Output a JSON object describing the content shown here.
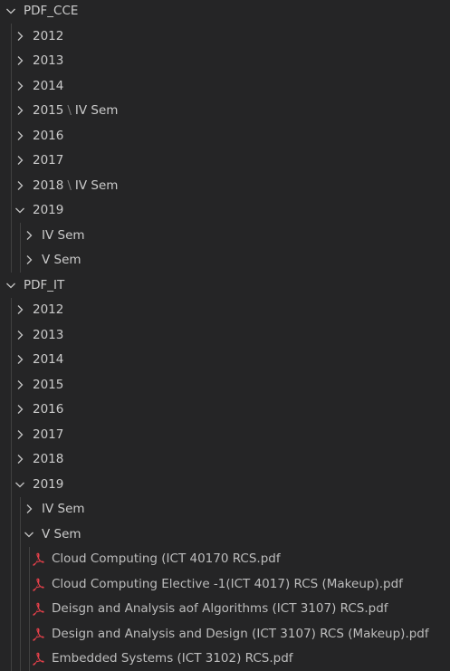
{
  "explorer": {
    "rows": [
      {
        "depth": 0,
        "type": "folder",
        "expanded": true,
        "label": "PDF_CCE",
        "name": "folder-pdf-cce"
      },
      {
        "depth": 1,
        "type": "folder",
        "expanded": false,
        "label": "2012",
        "name": "folder-cce-2012"
      },
      {
        "depth": 1,
        "type": "folder",
        "expanded": false,
        "label": "2013",
        "name": "folder-cce-2013"
      },
      {
        "depth": 1,
        "type": "folder",
        "expanded": false,
        "label": "2014",
        "name": "folder-cce-2014"
      },
      {
        "depth": 1,
        "type": "folder",
        "expanded": false,
        "label": "2015",
        "sub": "IV Sem",
        "name": "folder-cce-2015"
      },
      {
        "depth": 1,
        "type": "folder",
        "expanded": false,
        "label": "2016",
        "name": "folder-cce-2016"
      },
      {
        "depth": 1,
        "type": "folder",
        "expanded": false,
        "label": "2017",
        "name": "folder-cce-2017"
      },
      {
        "depth": 1,
        "type": "folder",
        "expanded": false,
        "label": "2018",
        "sub": "IV Sem",
        "name": "folder-cce-2018"
      },
      {
        "depth": 1,
        "type": "folder",
        "expanded": true,
        "label": "2019",
        "name": "folder-cce-2019"
      },
      {
        "depth": 2,
        "type": "folder",
        "expanded": false,
        "label": "IV Sem",
        "name": "folder-cce-2019-iv-sem"
      },
      {
        "depth": 2,
        "type": "folder",
        "expanded": false,
        "label": "V Sem",
        "name": "folder-cce-2019-v-sem"
      },
      {
        "depth": 0,
        "type": "folder",
        "expanded": true,
        "label": "PDF_IT",
        "name": "folder-pdf-it"
      },
      {
        "depth": 1,
        "type": "folder",
        "expanded": false,
        "label": "2012",
        "name": "folder-it-2012"
      },
      {
        "depth": 1,
        "type": "folder",
        "expanded": false,
        "label": "2013",
        "name": "folder-it-2013"
      },
      {
        "depth": 1,
        "type": "folder",
        "expanded": false,
        "label": "2014",
        "name": "folder-it-2014"
      },
      {
        "depth": 1,
        "type": "folder",
        "expanded": false,
        "label": "2015",
        "name": "folder-it-2015"
      },
      {
        "depth": 1,
        "type": "folder",
        "expanded": false,
        "label": "2016",
        "name": "folder-it-2016"
      },
      {
        "depth": 1,
        "type": "folder",
        "expanded": false,
        "label": "2017",
        "name": "folder-it-2017"
      },
      {
        "depth": 1,
        "type": "folder",
        "expanded": false,
        "label": "2018",
        "name": "folder-it-2018"
      },
      {
        "depth": 1,
        "type": "folder",
        "expanded": true,
        "label": "2019",
        "name": "folder-it-2019"
      },
      {
        "depth": 2,
        "type": "folder",
        "expanded": false,
        "label": "IV Sem",
        "name": "folder-it-2019-iv-sem"
      },
      {
        "depth": 2,
        "type": "folder",
        "expanded": true,
        "label": "V Sem",
        "name": "folder-it-2019-v-sem"
      },
      {
        "depth": 3,
        "type": "file",
        "label": "Cloud Computing (ICT 40170 RCS.pdf",
        "name": "file-cloud-computing"
      },
      {
        "depth": 3,
        "type": "file",
        "label": "Cloud Computing Elective -1(ICT 4017) RCS (Makeup).pdf",
        "name": "file-cloud-computing-elective"
      },
      {
        "depth": 3,
        "type": "file",
        "label": "Deisgn and Analysis aof Algorithms (ICT 3107) RCS.pdf",
        "name": "file-design-analysis-algorithms"
      },
      {
        "depth": 3,
        "type": "file",
        "label": "Design and Analysis and Design (ICT 3107) RCS (Makeup).pdf",
        "name": "file-design-analysis-design-makeup"
      },
      {
        "depth": 3,
        "type": "file",
        "label": "Embedded Systems (ICT 3102) RCS.pdf",
        "name": "file-embedded-systems"
      }
    ]
  },
  "colors": {
    "background": "#252526",
    "text": "#cccccc",
    "file_text": "#bdbdbd",
    "pdf_icon": "#e5404a",
    "indent_guide": "#404040"
  }
}
